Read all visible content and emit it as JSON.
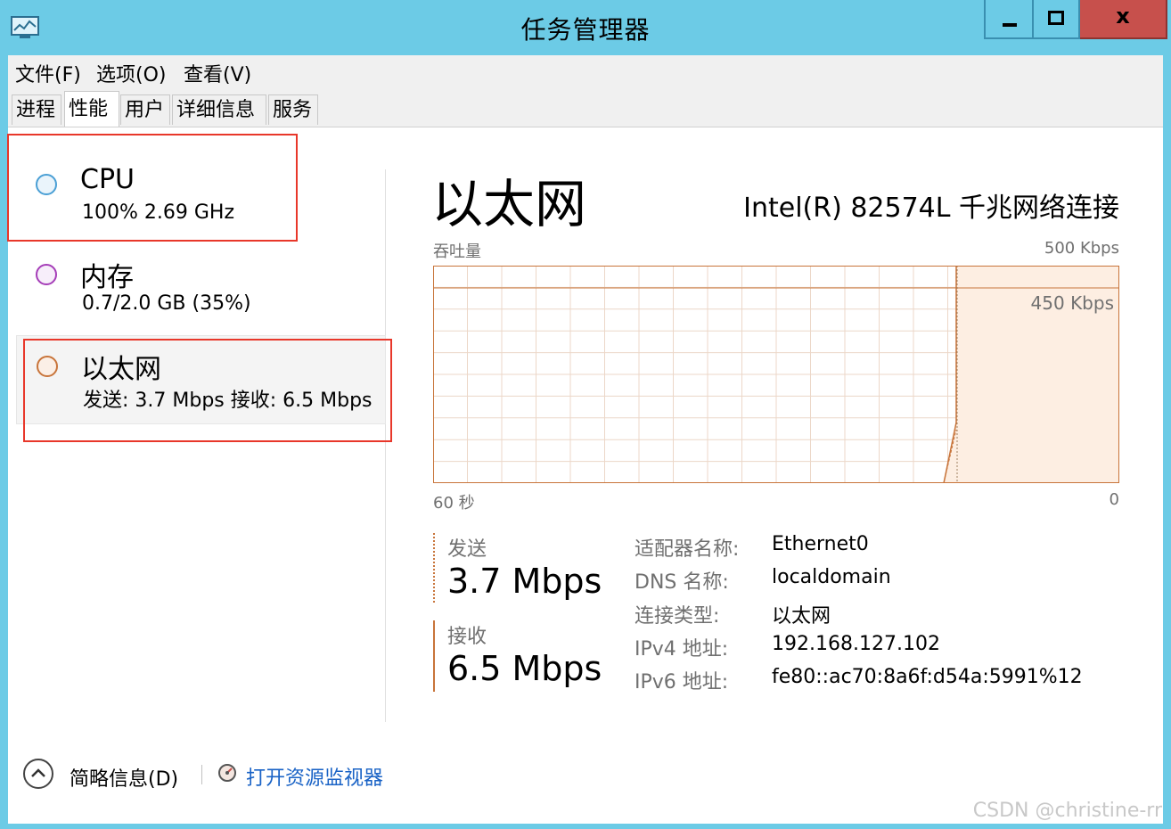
{
  "window": {
    "title": "任务管理器"
  },
  "title_buttons": {
    "close_glyph": "x"
  },
  "menu": [
    "文件(F)",
    "选项(O)",
    "查看(V)"
  ],
  "tabs": [
    "进程",
    "性能",
    "用户",
    "详细信息",
    "服务"
  ],
  "active_tab": "性能",
  "sidebar": {
    "items": [
      {
        "name": "CPU",
        "detail": "100%  2.69 GHz",
        "color": "#4a9fd5"
      },
      {
        "name": "内存",
        "detail": "0.7/2.0 GB (35%)",
        "color": "#a53db8"
      },
      {
        "name": "以太网",
        "detail": "发送: 3.7 Mbps 接收: 6.5 Mbps",
        "color": "#c8743a"
      }
    ]
  },
  "detail": {
    "title": "以太网",
    "adapter": "Intel(R) 82574L 千兆网络连接",
    "graph": {
      "label_left": "吞吐量",
      "label_right": "500 Kbps",
      "inner_label": "450 Kbps",
      "axis_left": "60 秒",
      "axis_right": "0",
      "line_color": "#c8743a",
      "fill_color": "#fdeee2"
    },
    "send": {
      "label": "发送",
      "value": "3.7 Mbps"
    },
    "receive": {
      "label": "接收",
      "value": "6.5 Mbps"
    },
    "properties": [
      {
        "label": "适配器名称:",
        "value": "Ethernet0"
      },
      {
        "label": "DNS 名称:",
        "value": "localdomain"
      },
      {
        "label": "连接类型:",
        "value": "以太网"
      },
      {
        "label": "IPv4 地址:",
        "value": "192.168.127.102"
      },
      {
        "label": "IPv6 地址:",
        "value": "fe80::ac70:8a6f:d54a:5991%12"
      }
    ]
  },
  "footer": {
    "summary_label": "简略信息(D)",
    "link_label": "打开资源监视器"
  },
  "watermark": "CSDN @christine-rr",
  "colors": {
    "titlebar": "#6ccbe6",
    "close": "#c7504c",
    "annotation_red": "#e8372a",
    "link": "#1a63c6"
  }
}
